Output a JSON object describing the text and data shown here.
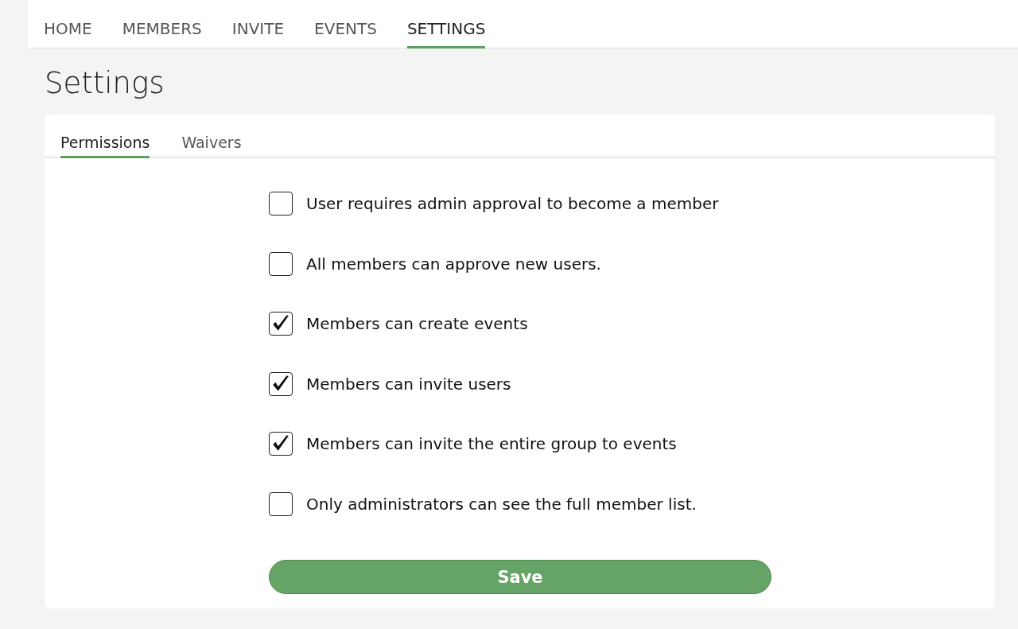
{
  "nav": [
    {
      "label": "HOME",
      "selected": false
    },
    {
      "label": "MEMBERS",
      "selected": false
    },
    {
      "label": "INVITE",
      "selected": false
    },
    {
      "label": "EVENTS",
      "selected": false
    },
    {
      "label": "SETTINGS",
      "selected": true
    }
  ],
  "page_title": "Settings",
  "tabs": [
    {
      "label": "Permissions",
      "selected": true
    },
    {
      "label": "Waivers",
      "selected": false
    }
  ],
  "permissions": [
    {
      "label": "User requires admin approval to become a member",
      "checked": false
    },
    {
      "label": "All members can approve new users.",
      "checked": false
    },
    {
      "label": "Members can create events",
      "checked": true
    },
    {
      "label": "Members can invite users",
      "checked": true
    },
    {
      "label": "Members can invite the entire group to events",
      "checked": true
    },
    {
      "label": "Only administrators can see the full member list.",
      "checked": false
    }
  ],
  "save_button": "Save"
}
